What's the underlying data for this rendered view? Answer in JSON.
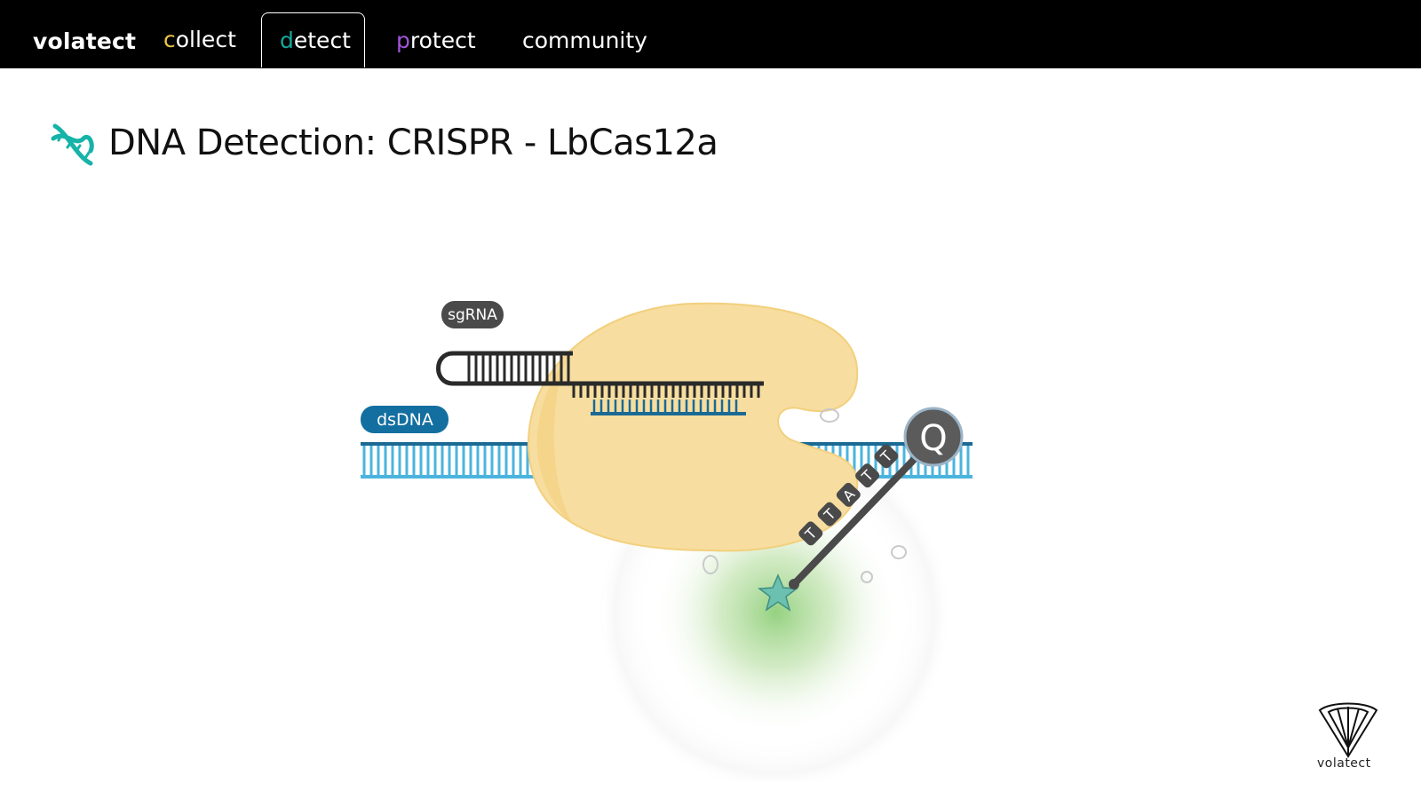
{
  "nav": {
    "brand": "volatect",
    "items": [
      {
        "first": "c",
        "rest": "ollect",
        "first_color": "#e8c547"
      },
      {
        "first": "d",
        "rest": "etect",
        "first_color": "#14a89a"
      },
      {
        "first": "p",
        "rest": "rotect",
        "first_color": "#a055d8"
      },
      {
        "first": "",
        "rest": "community",
        "first_color": "#ffffff"
      }
    ],
    "active_item": "detect"
  },
  "page": {
    "title": "DNA Detection: CRISPR - LbCas12a",
    "title_icon": "dna-icon",
    "title_icon_color": "#16b3a8"
  },
  "diagram": {
    "labels": {
      "sgrna": "sgRNA",
      "dsdna": "dsDNA",
      "quencher": "Q",
      "reporter_bases": [
        "T",
        "T",
        "A",
        "T",
        "T"
      ]
    },
    "colors": {
      "protein": "#f7dd9f",
      "protein_edge": "#f2d07d",
      "dna": "#4bb4de",
      "dna_dark": "#1a6a94",
      "rna": "#2a2a2a",
      "label_rna_bg": "#4a4a4a",
      "label_dna_bg": "#136fa0",
      "quencher": "#5b5b5b",
      "fluorophore": "#6cc0b0",
      "glow": "#8fcf7a"
    }
  },
  "footer": {
    "logo_label": "volatect",
    "logo_icon": "volatect-logo-icon"
  }
}
